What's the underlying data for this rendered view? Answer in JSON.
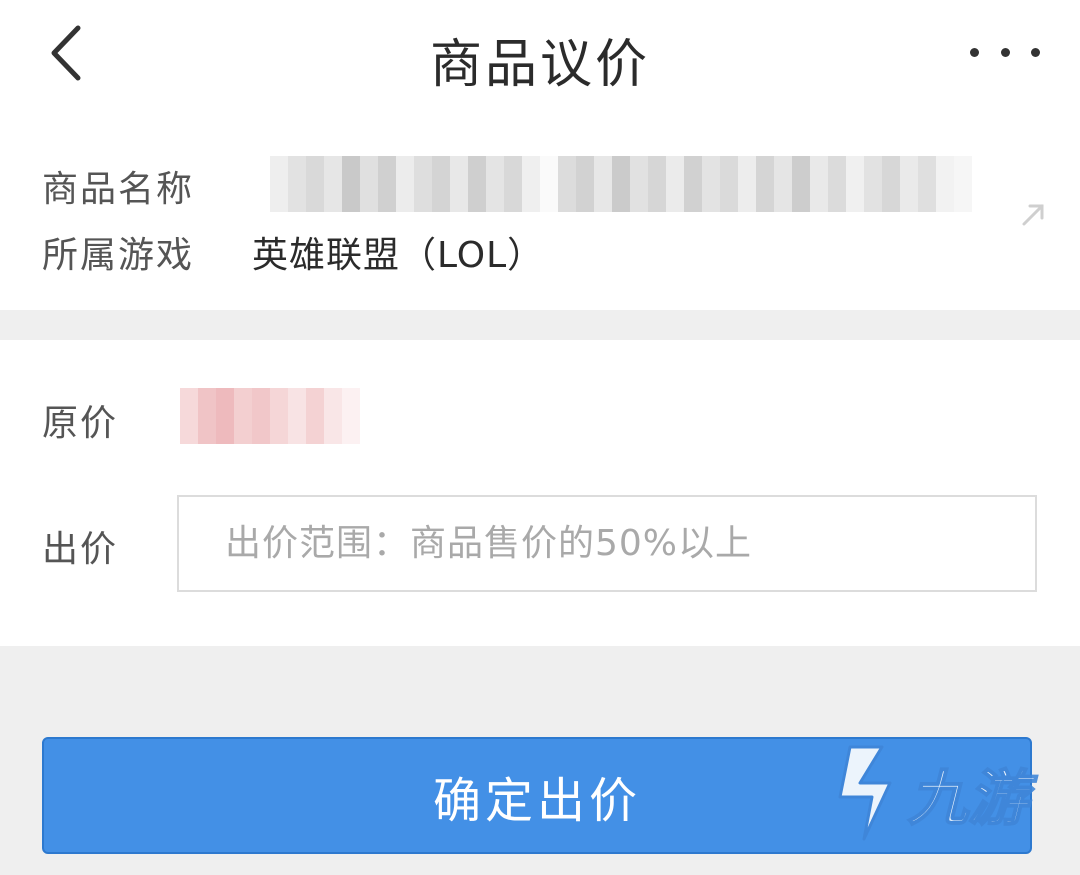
{
  "header": {
    "title": "商品议价",
    "back_icon": "chevron-left-icon",
    "more_icon": "more-horizontal-icon"
  },
  "product": {
    "name_label": "商品名称",
    "game_label": "所属游戏",
    "game_value": "英雄联盟（LOL）",
    "link_icon": "arrow-up-right-icon"
  },
  "price": {
    "original_label": "原价",
    "offer_label": "出价",
    "offer_placeholder": "出价范围：商品售价的50%以上",
    "offer_value": ""
  },
  "actions": {
    "confirm_label": "确定出价"
  },
  "watermark": {
    "text": "九游",
    "logo_icon": "jiuyou-logo-icon"
  },
  "colors": {
    "primary": "#4390e6",
    "background": "#efefef",
    "card": "#ffffff"
  }
}
